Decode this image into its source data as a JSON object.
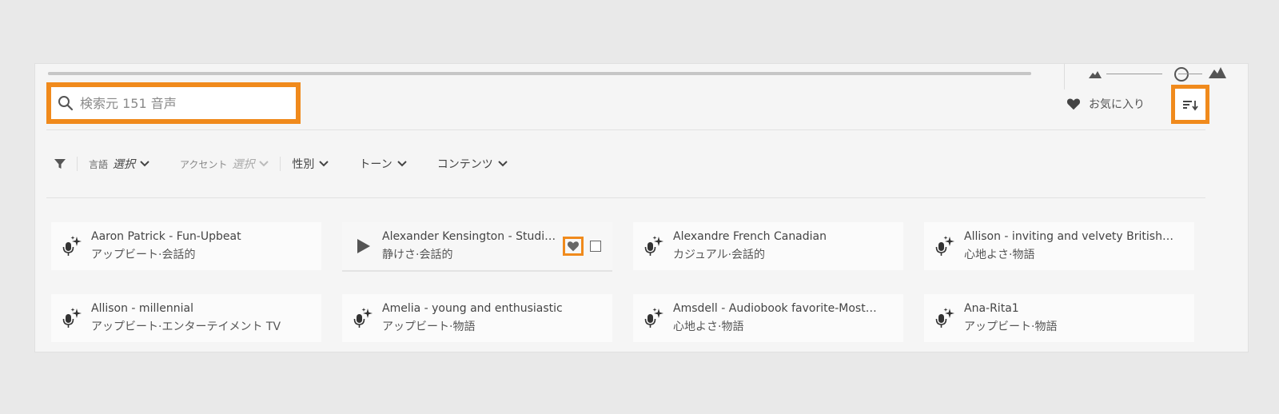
{
  "progress": {
    "fraction": 1.0
  },
  "zoom": {
    "level": 0.78
  },
  "search": {
    "placeholder": "検索元 151 音声",
    "value": ""
  },
  "favorites": {
    "label": "お気に入り"
  },
  "filters": {
    "language": {
      "label": "言語",
      "value": "選択"
    },
    "accent": {
      "label": "アクセント",
      "value": "選択"
    },
    "gender": {
      "label": "性別"
    },
    "tone": {
      "label": "トーン"
    },
    "content": {
      "label": "コンテンツ"
    }
  },
  "voices": [
    {
      "name": "Aaron Patrick - Fun-Upbeat",
      "tags": "アップビート·会話的"
    },
    {
      "name": "Alexander Kensington - Studio…",
      "tags": "静けさ·会話的"
    },
    {
      "name": "Alexandre French Canadian",
      "tags": "カジュアル·会話的"
    },
    {
      "name": "Allison - inviting and velvety British…",
      "tags": "心地よさ·物語"
    },
    {
      "name": "Allison - millennial",
      "tags": "アップビート·エンターテイメント TV"
    },
    {
      "name": "Amelia - young and enthusiastic",
      "tags": "アップビート·物語"
    },
    {
      "name": "Amsdell - Audiobook favorite-Most…",
      "tags": "心地よさ·物語"
    },
    {
      "name": "Ana-Rita1",
      "tags": "アップビート·物語"
    }
  ],
  "icons": {
    "search": "search-icon",
    "heart": "heart-icon",
    "sort": "sort-icon",
    "filter": "filter-icon",
    "chevron": "chevron-down-icon",
    "voice": "ai-voice-mic-icon",
    "play": "play-icon"
  },
  "colors": {
    "highlight": "#f08a1c",
    "panel": "#f5f5f5",
    "background": "#e9e9e9"
  }
}
